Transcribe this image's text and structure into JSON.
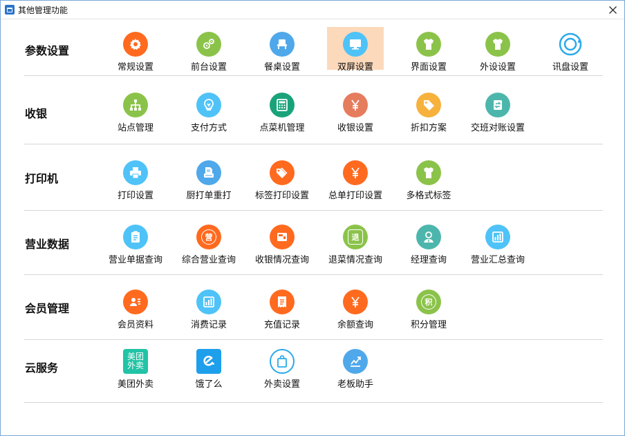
{
  "window": {
    "title": "其他管理功能"
  },
  "sections": [
    {
      "title": "参数设置",
      "items": [
        {
          "label": "常规设置",
          "icon": "gear-icon",
          "color": "#ff6a1f"
        },
        {
          "label": "前台设置",
          "icon": "gears-icon",
          "color": "#8bc34a"
        },
        {
          "label": "餐桌设置",
          "icon": "chair-icon",
          "color": "#4fa8ea"
        },
        {
          "label": "双屏设置",
          "icon": "monitor-icon",
          "color": "#4fc3f7",
          "selected": true
        },
        {
          "label": "界面设置",
          "icon": "shirt-icon",
          "color": "#8bc34a"
        },
        {
          "label": "外设设置",
          "icon": "shirt-icon",
          "color": "#8bc34a"
        },
        {
          "label": "讯盘设置",
          "icon": "ring-icon",
          "color": "#29a9ea"
        }
      ]
    },
    {
      "title": "收银",
      "items": [
        {
          "label": "站点管理",
          "icon": "sitemap-icon",
          "color": "#8bc34a"
        },
        {
          "label": "支付方式",
          "icon": "lightbulb-icon",
          "color": "#4fc3f7"
        },
        {
          "label": "点菜机管理",
          "icon": "calculator-icon",
          "color": "#1aa37a"
        },
        {
          "label": "收银设置",
          "icon": "yen-icon",
          "color": "#e67c5e"
        },
        {
          "label": "折扣方案",
          "icon": "tag-icon",
          "color": "#f6b23c"
        },
        {
          "label": "交班对账设置",
          "icon": "exchange-icon",
          "color": "#4db6ac"
        }
      ]
    },
    {
      "title": "打印机",
      "items": [
        {
          "label": "打印设置",
          "icon": "printer-icon",
          "color": "#4fc3f7"
        },
        {
          "label": "厨打单重打",
          "icon": "document-print-icon",
          "color": "#4fa8ea"
        },
        {
          "label": "标签打印设置",
          "icon": "tags-icon",
          "color": "#ff6a1f"
        },
        {
          "label": "总单打印设置",
          "icon": "yen-icon",
          "color": "#ff6a1f"
        },
        {
          "label": "多格式标签",
          "icon": "shirt-icon",
          "color": "#8bc34a"
        }
      ]
    },
    {
      "title": "营业数据",
      "items": [
        {
          "label": "营业单据查询",
          "icon": "clipboard-icon",
          "color": "#4fc3f7"
        },
        {
          "label": "综合营业查询",
          "icon": "ying-icon",
          "color": "#ff6a1f",
          "glyph": "营"
        },
        {
          "label": "收银情况查询",
          "icon": "register-icon",
          "color": "#ff6a1f"
        },
        {
          "label": "退菜情况查询",
          "icon": "tui-icon",
          "color": "#8bc34a",
          "glyph": "退"
        },
        {
          "label": "经理查询",
          "icon": "manager-icon",
          "color": "#4db6ac"
        },
        {
          "label": "营业汇总查询",
          "icon": "bar-chart-icon",
          "color": "#4fc3f7"
        }
      ]
    },
    {
      "title": "会员管理",
      "items": [
        {
          "label": "会员资料",
          "icon": "member-card-icon",
          "color": "#ff6a1f"
        },
        {
          "label": "消费记录",
          "icon": "bar-chart-icon",
          "color": "#4fc3f7"
        },
        {
          "label": "充值记录",
          "icon": "receipt-icon",
          "color": "#ff6a1f"
        },
        {
          "label": "余额查询",
          "icon": "yen-icon",
          "color": "#ff6a1f"
        },
        {
          "label": "积分管理",
          "icon": "ji-icon",
          "color": "#8bc34a",
          "glyph": "积"
        }
      ]
    },
    {
      "title": "云服务",
      "items": [
        {
          "label": "美团外卖",
          "icon": "meituan-logo-icon",
          "color": "#22c3a6",
          "glyph": "美团外卖"
        },
        {
          "label": "饿了么",
          "icon": "eleme-logo-icon",
          "color": "#1e9fec"
        },
        {
          "label": "外卖设置",
          "icon": "shopping-bag-icon",
          "color": "#29a9ea"
        },
        {
          "label": "老板助手",
          "icon": "trend-chart-icon",
          "color": "#4fa8ea"
        }
      ]
    }
  ]
}
